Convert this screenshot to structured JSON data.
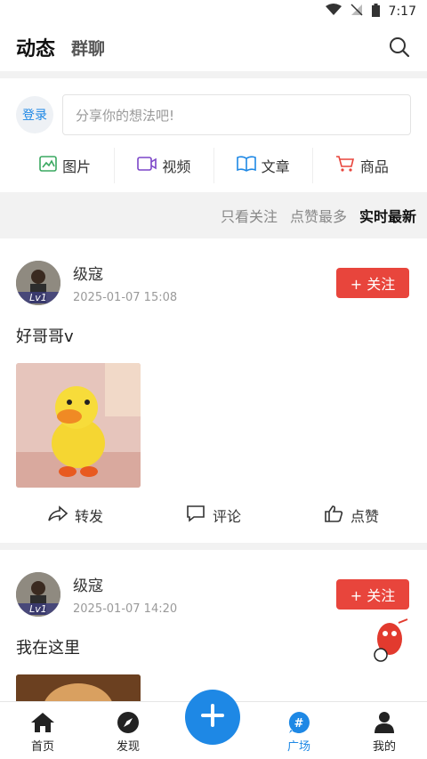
{
  "status_bar": {
    "time": "7:17"
  },
  "header": {
    "tab_active": "动态",
    "tab_other": "群聊"
  },
  "composer": {
    "login_label": "登录",
    "placeholder": "分享你的想法吧!",
    "actions": [
      "图片",
      "视频",
      "文章",
      "商品"
    ]
  },
  "filters": {
    "items": [
      "只看关注",
      "点赞最多",
      "实时最新"
    ],
    "active": "实时最新"
  },
  "posts": [
    {
      "user": "级寇",
      "level": "Lv1",
      "time": "2025-01-07 15:08",
      "follow_label": "+ 关注",
      "text": "好哥哥v",
      "actions": {
        "share": "转发",
        "comment": "评论",
        "like": "点赞"
      }
    },
    {
      "user": "级寇",
      "level": "Lv1",
      "time": "2025-01-07 14:20",
      "follow_label": "+ 关注",
      "text": "我在这里"
    }
  ],
  "tabbar": {
    "items": [
      "首页",
      "发现",
      "广场",
      "我的"
    ],
    "active": "广场"
  },
  "colors": {
    "accent": "#1e88e5",
    "follow": "#e8453c"
  }
}
